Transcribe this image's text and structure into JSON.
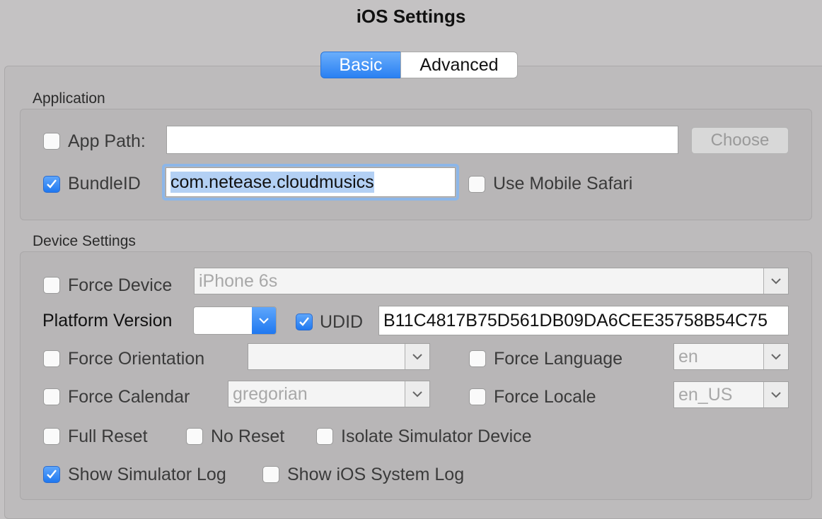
{
  "window": {
    "title": "iOS Settings"
  },
  "tabs": [
    {
      "label": "Basic"
    },
    {
      "label": "Advanced"
    }
  ],
  "application": {
    "section_label": "Application",
    "app_path": {
      "label": "App Path:",
      "checked": false,
      "value": ""
    },
    "choose_label": "Choose",
    "bundle_id": {
      "label": "BundleID",
      "checked": true,
      "value": "com.netease.cloudmusics"
    },
    "use_mobile_safari": {
      "label": "Use Mobile Safari",
      "checked": false
    }
  },
  "device": {
    "section_label": "Device Settings",
    "force_device": {
      "label": "Force Device",
      "checked": false,
      "value": "iPhone 6s"
    },
    "platform_version": {
      "label": "Platform Version",
      "value": ""
    },
    "udid": {
      "label": "UDID",
      "checked": true,
      "value": "B11C4817B75D561DB09DA6CEE35758B54C75"
    },
    "force_orientation": {
      "label": "Force Orientation",
      "checked": false,
      "value": ""
    },
    "force_language": {
      "label": "Force Language",
      "checked": false,
      "value": "en"
    },
    "force_calendar": {
      "label": "Force Calendar",
      "checked": false,
      "value": "gregorian"
    },
    "force_locale": {
      "label": "Force Locale",
      "checked": false,
      "value": "en_US"
    },
    "full_reset": {
      "label": "Full Reset",
      "checked": false
    },
    "no_reset": {
      "label": "No Reset",
      "checked": false
    },
    "isolate_sim": {
      "label": "Isolate Simulator Device",
      "checked": false
    },
    "show_sim_log": {
      "label": "Show Simulator Log",
      "checked": true
    },
    "show_ios_log": {
      "label": "Show iOS System Log",
      "checked": false
    }
  },
  "colors": {
    "accent": "#2a80f2",
    "selection": "#b3d0f4"
  }
}
